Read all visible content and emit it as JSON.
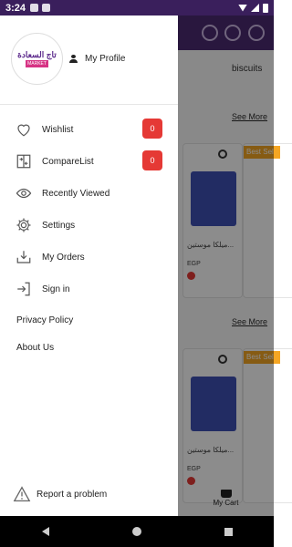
{
  "status_bar": {
    "time": "3:24"
  },
  "background": {
    "category_label": "biscuits",
    "see_more_1": "See More",
    "see_more_2": "See More",
    "product_name": "ميلكا موستين...",
    "price_currency": "EGP",
    "best_seller_label": "Best Sel",
    "cart_label": "My Cart"
  },
  "drawer": {
    "logo_text": "تاج السعادة",
    "logo_subtext": "MARKET",
    "profile_label": "My Profile",
    "menu": [
      {
        "label": "Wishlist",
        "icon": "heart-icon",
        "count": "0"
      },
      {
        "label": "CompareList",
        "icon": "compare-icon",
        "count": "0"
      },
      {
        "label": "Recently Viewed",
        "icon": "eye-icon"
      },
      {
        "label": "Settings",
        "icon": "gear-icon"
      },
      {
        "label": "My Orders",
        "icon": "orders-icon"
      },
      {
        "label": "Sign in",
        "icon": "sign-in-icon"
      }
    ],
    "privacy_policy": "Privacy Policy",
    "about_us": "About Us",
    "report_problem": "Report a problem"
  },
  "colors": {
    "accent": "#4b2a72",
    "badge": "#e53935",
    "best_seller": "#f5a623"
  }
}
